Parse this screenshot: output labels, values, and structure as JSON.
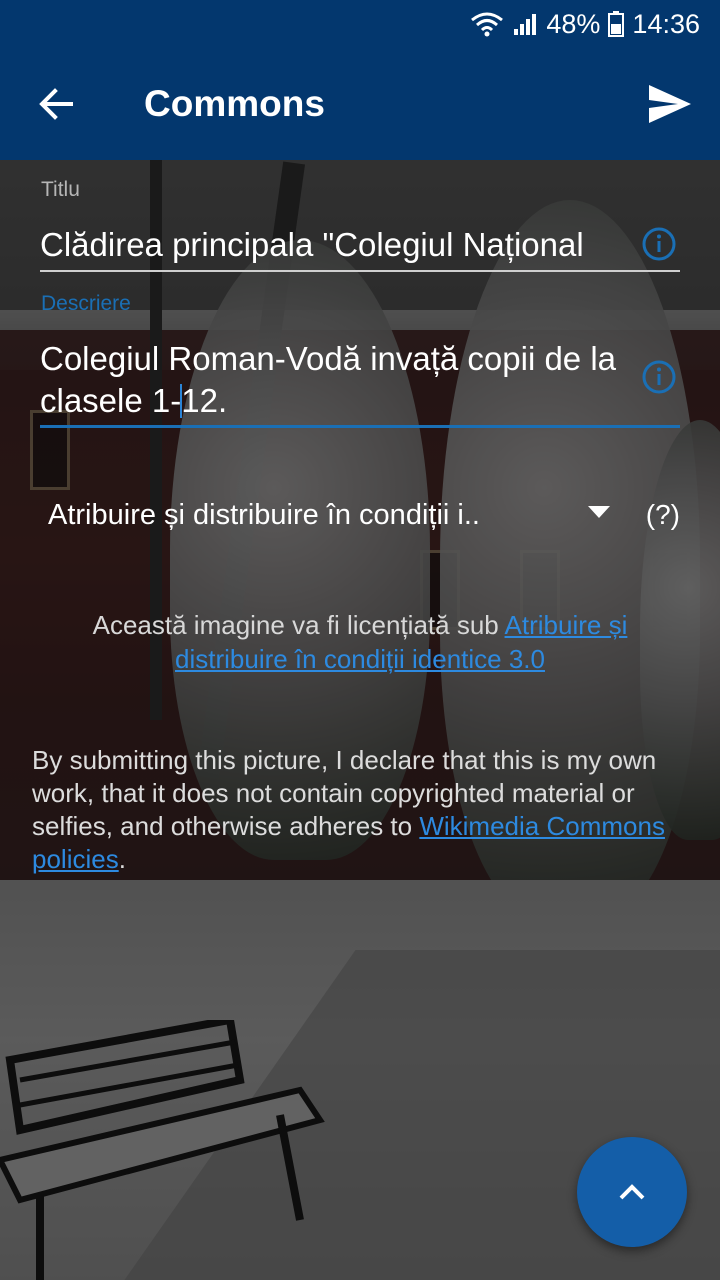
{
  "status_bar": {
    "battery": "48%",
    "time": "14:36",
    "icons": [
      "wifi-icon",
      "signal-icon",
      "battery-icon"
    ]
  },
  "app_bar": {
    "title": "Commons",
    "back_icon": "arrow-back-icon",
    "submit_icon": "send-icon"
  },
  "form": {
    "title_label": "Titlu",
    "title_value": "Clădirea principala \"Colegiul Național",
    "description_label": "Descriere",
    "description_value_before_cursor": "Colegiul Roman-Vodă invață copii de la clasele 1-",
    "description_value_after_cursor": "12.",
    "license_selected": "Atribuire și distribuire în condiții i..",
    "help_label": "(?)"
  },
  "license_note": {
    "prefix": "Această imagine va fi licențiată sub ",
    "link": "Atribuire și distribuire în condiții identice 3.0"
  },
  "declaration": {
    "text": "By submitting this picture, I declare that this is my own work, that it does not contain copyrighted material or selfies, and otherwise adheres to ",
    "link": "Wikimedia Commons policies",
    "suffix": "."
  },
  "fab": {
    "icon": "chevron-up-icon"
  },
  "colors": {
    "primary": "#03376e",
    "accent": "#1a6fb5",
    "link": "#2d8ae0",
    "fab": "#145ea8"
  }
}
